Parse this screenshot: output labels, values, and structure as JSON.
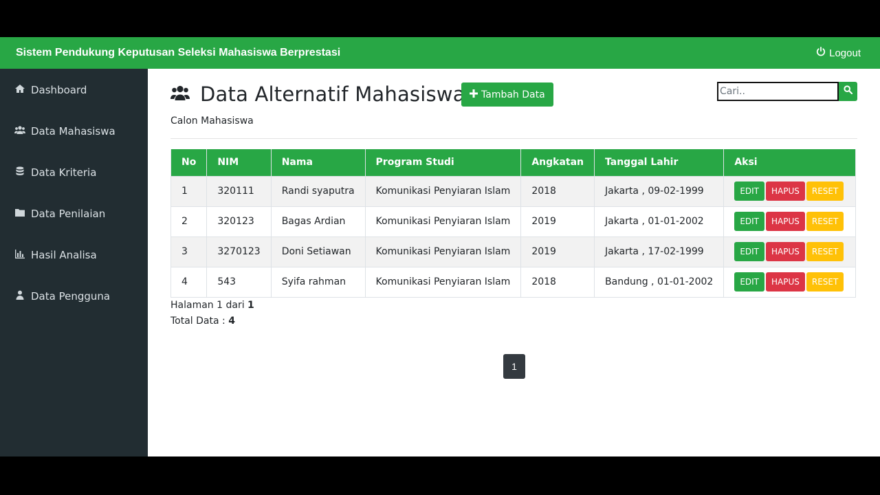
{
  "app": {
    "title": "Sistem Pendukung Keputusan Seleksi Mahasiswa Berprestasi",
    "logout_label": "Logout"
  },
  "sidebar": {
    "items": [
      {
        "label": "Dashboard",
        "icon": "home-icon"
      },
      {
        "label": "Data Mahasiswa",
        "icon": "users-icon"
      },
      {
        "label": "Data Kriteria",
        "icon": "database-icon"
      },
      {
        "label": "Data Penilaian",
        "icon": "folder-icon"
      },
      {
        "label": "Hasil Analisa",
        "icon": "bar-chart-icon"
      },
      {
        "label": "Data Pengguna",
        "icon": "user-icon"
      }
    ]
  },
  "main": {
    "title": "Data Alternatif Mahasiswa",
    "subtitle": "Calon Mahasiswa",
    "add_label": "Tambah Data",
    "search": {
      "placeholder": "Cari..",
      "value": ""
    }
  },
  "table": {
    "headers": [
      "No",
      "NIM",
      "Nama",
      "Program Studi",
      "Angkatan",
      "Tanggal Lahir",
      "Aksi"
    ],
    "rows": [
      [
        "1",
        "320111",
        "Randi syaputra",
        "Komunikasi Penyiaran Islam",
        "2018",
        "Jakarta , 09-02-1999"
      ],
      [
        "2",
        "320123",
        "Bagas Ardian",
        "Komunikasi Penyiaran Islam",
        "2019",
        "Jakarta , 01-01-2002"
      ],
      [
        "3",
        "3270123",
        "Doni Setiawan",
        "Komunikasi Penyiaran Islam",
        "2019",
        "Jakarta , 17-02-1999"
      ],
      [
        "4",
        "543",
        "Syifa rahman",
        "Komunikasi Penyiaran Islam",
        "2018",
        "Bandung , 01-01-2002"
      ]
    ],
    "actions": {
      "edit": "EDIT",
      "delete": "HAPUS",
      "reset": "RESET"
    }
  },
  "pagination": {
    "page_text": "Halaman 1 dari",
    "total_pages": "1",
    "total_text": "Total Data :",
    "total_count": "4",
    "current_page": "1"
  },
  "colors": {
    "primary": "#28a745",
    "danger": "#dc3545",
    "warning": "#ffc107",
    "sidebar": "#222d32",
    "pager": "#343a40"
  }
}
